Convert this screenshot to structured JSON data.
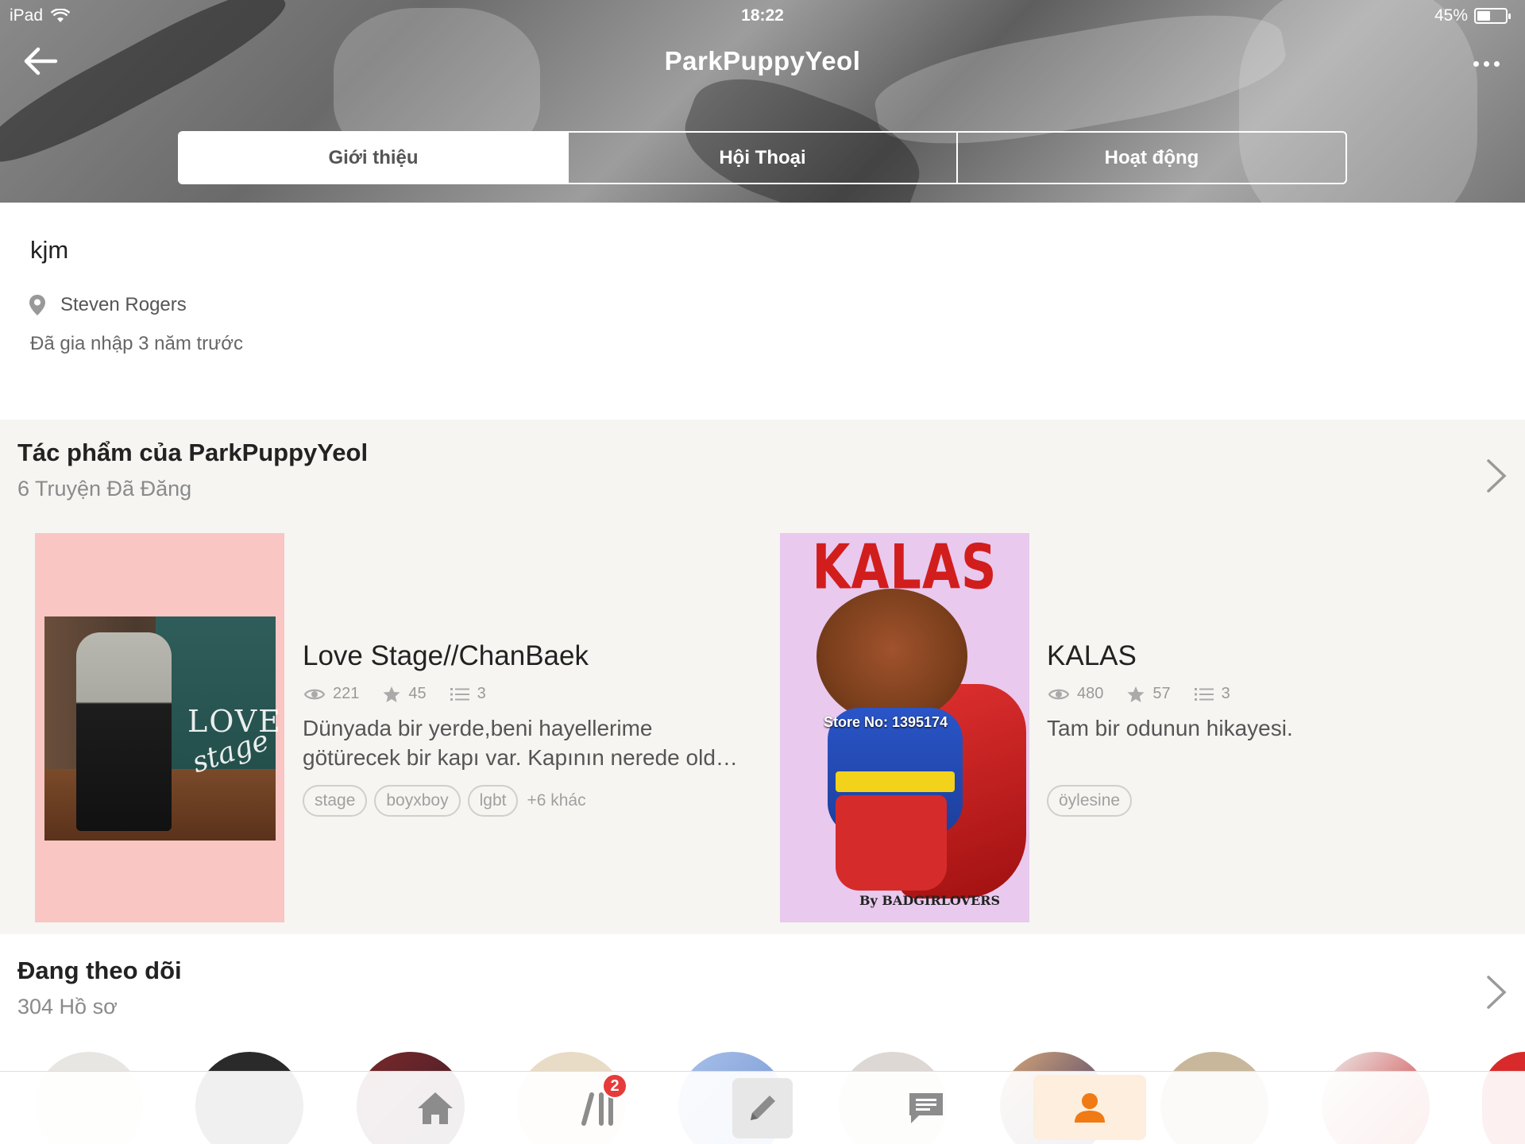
{
  "status_bar": {
    "device": "iPad",
    "time": "18:22",
    "battery_percent": "45%",
    "battery_level": 0.45
  },
  "header": {
    "title": "ParkPuppyYeol",
    "tabs": [
      {
        "label": "Giới thiệu",
        "active": true
      },
      {
        "label": "Hội Thoại",
        "active": false
      },
      {
        "label": "Hoạt động",
        "active": false
      }
    ]
  },
  "about": {
    "display_name": "kjm",
    "location": "Steven Rogers",
    "joined": "Đã gia nhập 3 năm trước"
  },
  "works": {
    "title": "Tác phẩm của ParkPuppyYeol",
    "subtitle": "6 Truyện Đã Đăng",
    "stories": [
      {
        "title": "Love Stage//ChanBaek",
        "reads": "221",
        "votes": "45",
        "parts": "3",
        "description": "Dünyada bir yerde,beni hayellerime götürecek bir kapı var. Kapının nerede old…",
        "tags": [
          "stage",
          "boyxboy",
          "lgbt"
        ],
        "more_tags": "+6 khác",
        "cover_text": [
          "LOVE",
          "stage"
        ]
      },
      {
        "title": "KALAS",
        "reads": "480",
        "votes": "57",
        "parts": "3",
        "description": "Tam bir odunun hikayesi.",
        "tags": [
          "öylesine"
        ],
        "more_tags": "",
        "cover_text": [
          "KALAS",
          "Store No: 1395174",
          "By BADGIRLOVERS"
        ]
      }
    ]
  },
  "following": {
    "title": "Đang theo dõi",
    "subtitle": "304 Hồ sơ"
  },
  "tabbar": {
    "library_badge": "2",
    "items": [
      "home",
      "library",
      "write",
      "messages",
      "profile"
    ],
    "active": "profile",
    "accent_color": "#f07a14"
  },
  "colors": {
    "tag_border": "#cfcfcf",
    "section_bg": "#f6f5f2",
    "badge": "#e63b3b"
  }
}
